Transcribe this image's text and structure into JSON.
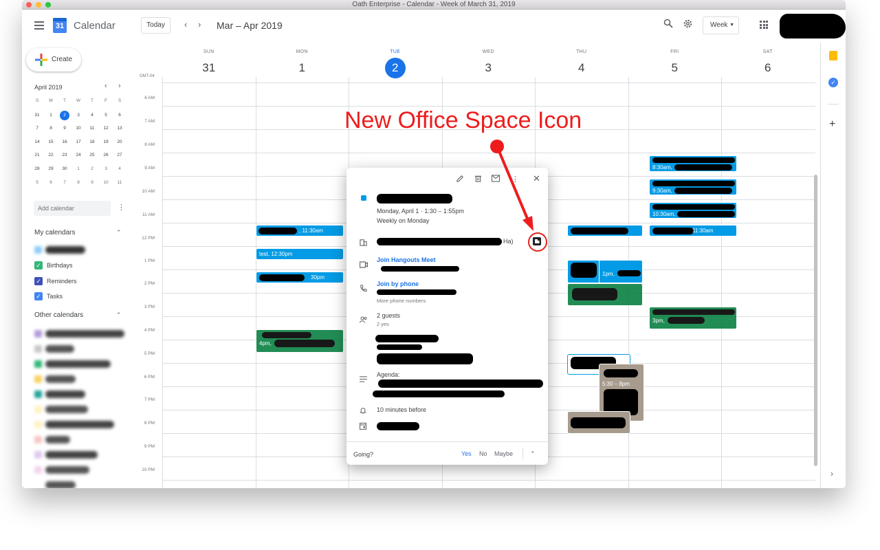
{
  "window": {
    "title": "Oath Enterprise - Calendar - Week of March 31, 2019"
  },
  "header": {
    "app_name": "Calendar",
    "logo_day": "31",
    "today_label": "Today",
    "prev_icon": "chevron-left-icon",
    "next_icon": "chevron-right-icon",
    "date_range": "Mar – Apr 2019",
    "view_label": "Week"
  },
  "sidebar": {
    "create_label": "Create",
    "mini_month": "April 2019",
    "dow": [
      "S",
      "M",
      "T",
      "W",
      "T",
      "F",
      "S"
    ],
    "mini_weeks": [
      [
        "31",
        "1",
        "2",
        "3",
        "4",
        "5",
        "6"
      ],
      [
        "7",
        "8",
        "9",
        "10",
        "11",
        "12",
        "13"
      ],
      [
        "14",
        "15",
        "16",
        "17",
        "18",
        "19",
        "20"
      ],
      [
        "21",
        "22",
        "23",
        "24",
        "25",
        "26",
        "27"
      ],
      [
        "28",
        "29",
        "30",
        "1",
        "2",
        "3",
        "4"
      ],
      [
        "5",
        "6",
        "7",
        "8",
        "9",
        "10",
        "11"
      ]
    ],
    "add_calendar_placeholder": "Add calendar",
    "my_calendars_title": "My calendars",
    "my_calendars": [
      {
        "label": "Birthdays",
        "color": "#33b679"
      },
      {
        "label": "Reminders",
        "color": "#3f51b5"
      },
      {
        "label": "Tasks",
        "color": "#4285f4"
      }
    ],
    "other_calendars_title": "Other calendars"
  },
  "week": {
    "timezone": "GMT-04",
    "days": [
      {
        "dow": "SUN",
        "num": "31"
      },
      {
        "dow": "MON",
        "num": "1"
      },
      {
        "dow": "TUE",
        "num": "2"
      },
      {
        "dow": "WED",
        "num": "3"
      },
      {
        "dow": "THU",
        "num": "4"
      },
      {
        "dow": "FRI",
        "num": "5"
      },
      {
        "dow": "SAT",
        "num": "6"
      }
    ],
    "hours": [
      "6 AM",
      "7 AM",
      "8 AM",
      "9 AM",
      "10 AM",
      "11 AM",
      "12 PM",
      "1 PM",
      "2 PM",
      "3 PM",
      "4 PM",
      "5 PM",
      "6 PM",
      "7 PM",
      "8 PM",
      "9 PM",
      "10 PM"
    ]
  },
  "events": {
    "mon_1130": ", 11:30am",
    "mon_test": "test, 12:30pm",
    "mon_130": "30pm",
    "mon_4pm": "4pm,",
    "fri_830": "8:30am,",
    "fri_930": "9:30am,",
    "fri_1030": "10:30am,",
    "fri_1130": "11:30am",
    "fri_3pm": "3pm,",
    "thu_1pm": "1pm,",
    "thu_530": "5:30 – 8pm"
  },
  "popup": {
    "edit_icon": "pencil-icon",
    "delete_icon": "trash-icon",
    "email_icon": "mail-icon",
    "more_icon": "more-vert-icon",
    "close_icon": "close-icon",
    "datetime": "Monday, April 1  ·  1:30 – 1:55pm",
    "recurrence": "Weekly on Monday",
    "room_suffix": "Ha)",
    "hangouts_label": "Join Hangouts Meet",
    "phone_label": "Join by phone",
    "more_phone": "More phone numbers",
    "guests": "2 guests",
    "guests_yes": "2 yes",
    "agenda_label": "Agenda:",
    "reminder": "10 minutes before",
    "going_label": "Going?",
    "yes": "Yes",
    "no": "No",
    "maybe": "Maybe"
  },
  "annotation": {
    "text": "New Office Space Icon",
    "color": "#ee1c1c"
  }
}
